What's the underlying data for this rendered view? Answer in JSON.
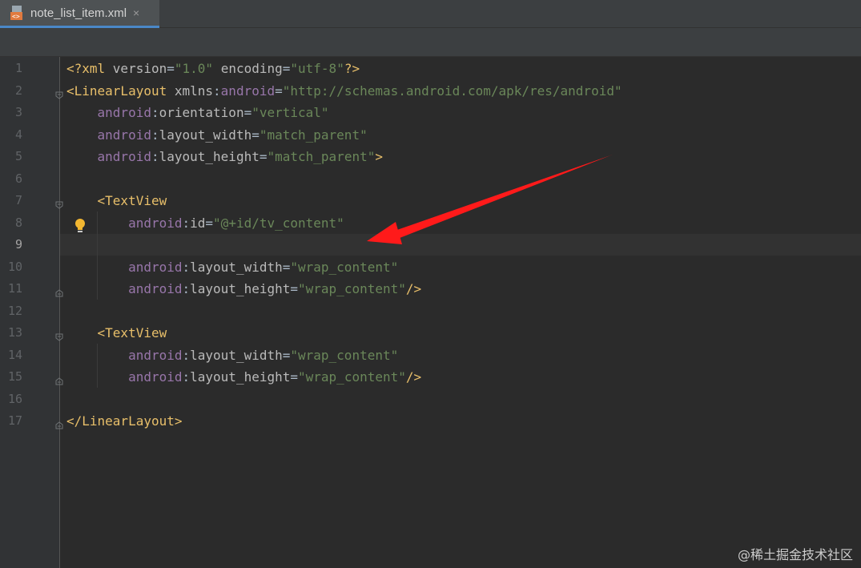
{
  "tab": {
    "title": "note_list_item.xml",
    "close": "×"
  },
  "lines": [
    {
      "n": "1",
      "tokens": [
        [
          "tag",
          "<?xml "
        ],
        [
          "attr",
          "version"
        ],
        [
          "plain",
          "="
        ],
        [
          "val",
          "\"1.0\""
        ],
        [
          "plain",
          " "
        ],
        [
          "attr",
          "encoding"
        ],
        [
          "plain",
          "="
        ],
        [
          "val",
          "\"utf-8\""
        ],
        [
          "tag",
          "?>"
        ]
      ]
    },
    {
      "n": "2",
      "tokens": [
        [
          "tag",
          "<LinearLayout "
        ],
        [
          "attr",
          "xmlns"
        ],
        [
          "plain",
          ":"
        ],
        [
          "ns",
          "android"
        ],
        [
          "plain",
          "="
        ],
        [
          "val",
          "\"http://schemas.android.com/apk/res/android\""
        ]
      ]
    },
    {
      "n": "3",
      "tokens": [
        [
          "plain",
          "    "
        ],
        [
          "ns",
          "android"
        ],
        [
          "plain",
          ":"
        ],
        [
          "attr",
          "orientation"
        ],
        [
          "plain",
          "="
        ],
        [
          "val",
          "\"vertical\""
        ]
      ]
    },
    {
      "n": "4",
      "tokens": [
        [
          "plain",
          "    "
        ],
        [
          "ns",
          "android"
        ],
        [
          "plain",
          ":"
        ],
        [
          "attr",
          "layout_width"
        ],
        [
          "plain",
          "="
        ],
        [
          "val",
          "\"match_parent\""
        ]
      ]
    },
    {
      "n": "5",
      "tokens": [
        [
          "plain",
          "    "
        ],
        [
          "ns",
          "android"
        ],
        [
          "plain",
          ":"
        ],
        [
          "attr",
          "layout_height"
        ],
        [
          "plain",
          "="
        ],
        [
          "val",
          "\"match_parent\""
        ],
        [
          "tag",
          ">"
        ]
      ]
    },
    {
      "n": "6",
      "tokens": []
    },
    {
      "n": "7",
      "tokens": [
        [
          "plain",
          "    "
        ],
        [
          "tag",
          "<TextView"
        ]
      ]
    },
    {
      "n": "8",
      "tokens": [
        [
          "plain",
          "        "
        ],
        [
          "ns",
          "android"
        ],
        [
          "plain",
          ":"
        ],
        [
          "attr",
          "id"
        ],
        [
          "plain",
          "="
        ],
        [
          "val",
          "\"@+id/tv_content\""
        ]
      ]
    },
    {
      "n": "9",
      "tokens": []
    },
    {
      "n": "10",
      "tokens": [
        [
          "plain",
          "        "
        ],
        [
          "ns",
          "android"
        ],
        [
          "plain",
          ":"
        ],
        [
          "attr",
          "layout_width"
        ],
        [
          "plain",
          "="
        ],
        [
          "val",
          "\"wrap_content\""
        ]
      ]
    },
    {
      "n": "11",
      "tokens": [
        [
          "plain",
          "        "
        ],
        [
          "ns",
          "android"
        ],
        [
          "plain",
          ":"
        ],
        [
          "attr",
          "layout_height"
        ],
        [
          "plain",
          "="
        ],
        [
          "val",
          "\"wrap_content\""
        ],
        [
          "tag",
          "/>"
        ]
      ]
    },
    {
      "n": "12",
      "tokens": []
    },
    {
      "n": "13",
      "tokens": [
        [
          "plain",
          "    "
        ],
        [
          "tag",
          "<TextView"
        ]
      ]
    },
    {
      "n": "14",
      "tokens": [
        [
          "plain",
          "        "
        ],
        [
          "ns",
          "android"
        ],
        [
          "plain",
          ":"
        ],
        [
          "attr",
          "layout_width"
        ],
        [
          "plain",
          "="
        ],
        [
          "val",
          "\"wrap_content\""
        ]
      ]
    },
    {
      "n": "15",
      "tokens": [
        [
          "plain",
          "        "
        ],
        [
          "ns",
          "android"
        ],
        [
          "plain",
          ":"
        ],
        [
          "attr",
          "layout_height"
        ],
        [
          "plain",
          "="
        ],
        [
          "val",
          "\"wrap_content\""
        ],
        [
          "tag",
          "/>"
        ]
      ]
    },
    {
      "n": "16",
      "tokens": []
    },
    {
      "n": "17",
      "tokens": [
        [
          "tag",
          "</LinearLayout>"
        ]
      ]
    }
  ],
  "current_line": "9",
  "watermark": "@稀土掘金技术社区",
  "colors": {
    "tag": "#e8bf6a",
    "namespace": "#9876aa",
    "attribute": "#bababa",
    "value": "#6a8759",
    "arrow": "#ff1a1a",
    "tab_underline": "#4a88c7"
  },
  "icons": [
    "xml-file-icon",
    "close-icon",
    "fold-marker-icon",
    "lightbulb-icon",
    "annotation-arrow-icon"
  ]
}
